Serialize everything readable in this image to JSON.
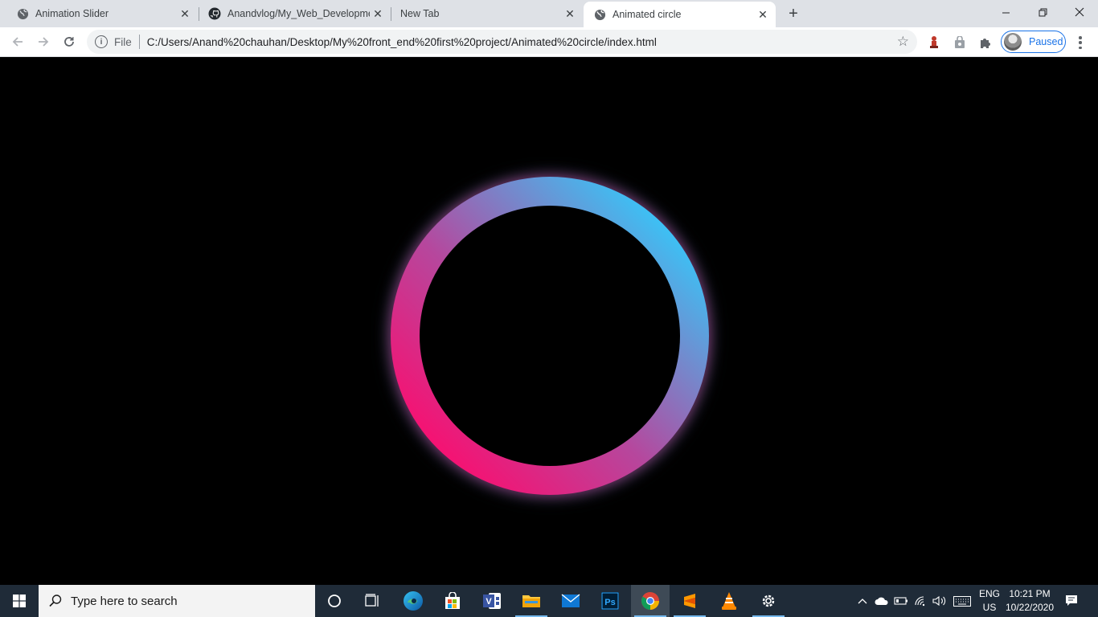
{
  "browser": {
    "tabs": [
      {
        "title": "Animation Slider",
        "icon": "globe-icon",
        "active": false
      },
      {
        "title": "Anandvlog/My_Web_Developme",
        "icon": "github-icon",
        "active": false
      },
      {
        "title": "New Tab",
        "icon": "none",
        "active": false
      },
      {
        "title": "Animated circle",
        "icon": "globe-icon",
        "active": true
      }
    ],
    "new_tab_symbol": "+",
    "window_controls": {
      "minimize": "–",
      "restore": "❐",
      "close": "✕"
    },
    "toolbar": {
      "scheme_label": "File",
      "url": "C:/Users/Anand%20chauhan/Desktop/My%20front_end%20first%20project/Animated%20circle/index.html",
      "profile_status": "Paused"
    }
  },
  "page": {
    "ring_colors": {
      "start": "#ff0a6c",
      "middle": "#b6479d",
      "end": "#2fcefe"
    },
    "background": "#000000"
  },
  "taskbar": {
    "search_placeholder": "Type here to search",
    "pinned_apps": [
      "cortana-icon",
      "task-view-icon",
      "edge-icon",
      "store-icon",
      "visio-icon",
      "file-explorer-icon",
      "mail-icon",
      "photoshop-icon",
      "chrome-icon",
      "sublime-text-icon",
      "vlc-icon",
      "settings-icon"
    ],
    "language": {
      "line1": "ENG",
      "line2": "US"
    },
    "clock": {
      "time": "10:21 PM",
      "date": "10/22/2020"
    }
  }
}
